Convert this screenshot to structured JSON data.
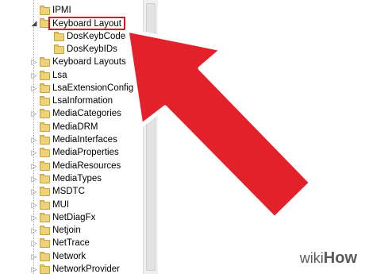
{
  "tree": {
    "items": [
      {
        "label": "IPMI",
        "expander": "none",
        "level": 1
      },
      {
        "label": "Keyboard Layout",
        "expander": "expanded",
        "level": 1,
        "selected": true
      },
      {
        "label": "DosKeybCodes",
        "expander": "none",
        "level": 2
      },
      {
        "label": "DosKeybIDs",
        "expander": "none",
        "level": 2
      },
      {
        "label": "Keyboard Layouts",
        "expander": "collapsed",
        "level": 1
      },
      {
        "label": "Lsa",
        "expander": "collapsed",
        "level": 1
      },
      {
        "label": "LsaExtensionConfig",
        "expander": "collapsed",
        "level": 1
      },
      {
        "label": "LsaInformation",
        "expander": "none",
        "level": 1
      },
      {
        "label": "MediaCategories",
        "expander": "collapsed",
        "level": 1
      },
      {
        "label": "MediaDRM",
        "expander": "none",
        "level": 1
      },
      {
        "label": "MediaInterfaces",
        "expander": "collapsed",
        "level": 1
      },
      {
        "label": "MediaProperties",
        "expander": "collapsed",
        "level": 1
      },
      {
        "label": "MediaResources",
        "expander": "collapsed",
        "level": 1
      },
      {
        "label": "MediaTypes",
        "expander": "collapsed",
        "level": 1
      },
      {
        "label": "MSDTC",
        "expander": "collapsed",
        "level": 1
      },
      {
        "label": "MUI",
        "expander": "collapsed",
        "level": 1
      },
      {
        "label": "NetDiagFx",
        "expander": "collapsed",
        "level": 1
      },
      {
        "label": "Netjoin",
        "expander": "collapsed",
        "level": 1
      },
      {
        "label": "NetTrace",
        "expander": "collapsed",
        "level": 1
      },
      {
        "label": "Network",
        "expander": "collapsed",
        "level": 1
      },
      {
        "label": "NetworkProvider",
        "expander": "collapsed",
        "level": 1
      }
    ]
  },
  "pointer": {
    "color": "#e3212b",
    "outline": "#ffffff",
    "icon": "big-arrow-pointer"
  },
  "highlight": {
    "color": "#d8151d"
  },
  "watermark": {
    "text_wiki": "wiki",
    "text_how": "How"
  }
}
